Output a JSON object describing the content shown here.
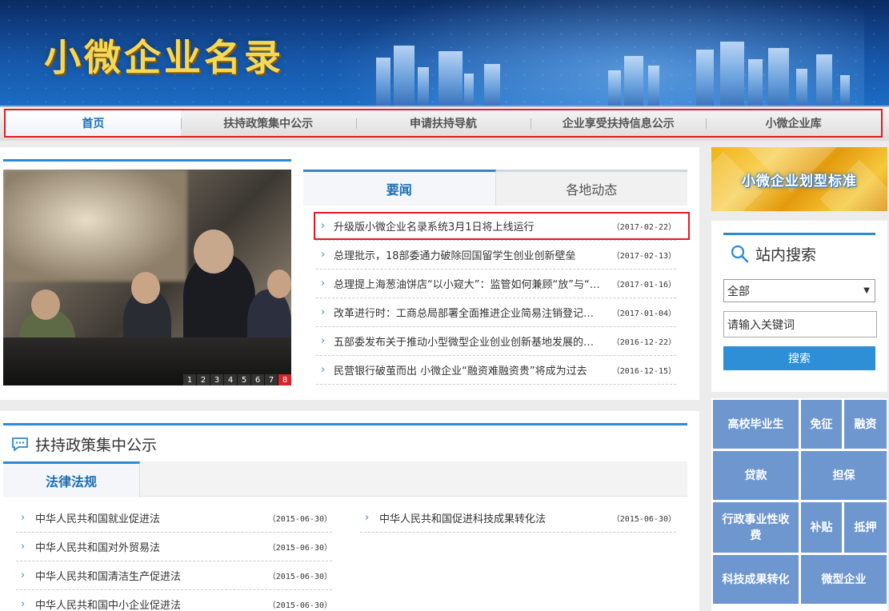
{
  "banner": {
    "title": "小微企业名录"
  },
  "nav": {
    "items": [
      {
        "label": "首页"
      },
      {
        "label": "扶持政策集中公示"
      },
      {
        "label": "申请扶持导航"
      },
      {
        "label": "企业享受扶持信息公示"
      },
      {
        "label": "小微企业库"
      }
    ],
    "active_index": 0
  },
  "slider": {
    "pages": [
      "1",
      "2",
      "3",
      "4",
      "5",
      "6",
      "7",
      "8"
    ],
    "active_page": "8"
  },
  "news": {
    "tabs": [
      {
        "label": "要闻"
      },
      {
        "label": "各地动态"
      }
    ],
    "items": [
      {
        "title": "升级版小微企业名录系统3月1日将上线运行",
        "date": "（2017-02-22）"
      },
      {
        "title": "总理批示，18部委通力破除回国留学生创业创新壁垒",
        "date": "（2017-02-13）"
      },
      {
        "title": "总理提上海葱油饼店“以小窥大”：监管如何兼顾“放”与“管”",
        "date": "（2017-01-16）"
      },
      {
        "title": "改革进行时：工商总局部署全面推进企业简易注销登记改革",
        "date": "（2017-01-04）"
      },
      {
        "title": "五部委发布关于推动小型微型企业创业创新基地发展的指导意见",
        "date": "（2016-12-22）"
      },
      {
        "title": "民营银行破茧而出 小微企业“融资难融资贵”将成为过去",
        "date": "（2016-12-15）"
      }
    ]
  },
  "policy": {
    "heading": "扶持政策集中公示",
    "tab": "法律法规",
    "laws_left": [
      {
        "title": "中华人民共和国就业促进法",
        "date": "（2015-06-30）"
      },
      {
        "title": "中华人民共和国对外贸易法",
        "date": "（2015-06-30）"
      },
      {
        "title": "中华人民共和国清洁生产促进法",
        "date": "（2015-06-30）"
      },
      {
        "title": "中华人民共和国中小企业促进法",
        "date": "（2015-06-30）"
      }
    ],
    "laws_right": [
      {
        "title": "中华人民共和国促进科技成果转化法",
        "date": "（2015-06-30）"
      }
    ]
  },
  "sidebar": {
    "promo": "小微企业划型标准",
    "search": {
      "heading": "站内搜索",
      "select_value": "全部",
      "input_value": "请输入关键词",
      "button": "搜索"
    },
    "tiles": {
      "t1": "高校毕业生",
      "t2": "免征",
      "t3": "融资",
      "t4": "贷款",
      "t5": "担保",
      "t6": "行政事业性收费",
      "t7": "补贴",
      "t8": "抵押",
      "t9": "科技成果转化",
      "t10": "微型企业"
    }
  },
  "colors": {
    "accent": "#2a8ad4",
    "highlight_frame": "#e11b22",
    "tile": "#6e96cf",
    "banner_title": "#f4d85a"
  },
  "icons": [
    "search-icon",
    "chat-bubble-icon",
    "chevron-right-icon",
    "dropdown-arrow-icon"
  ]
}
